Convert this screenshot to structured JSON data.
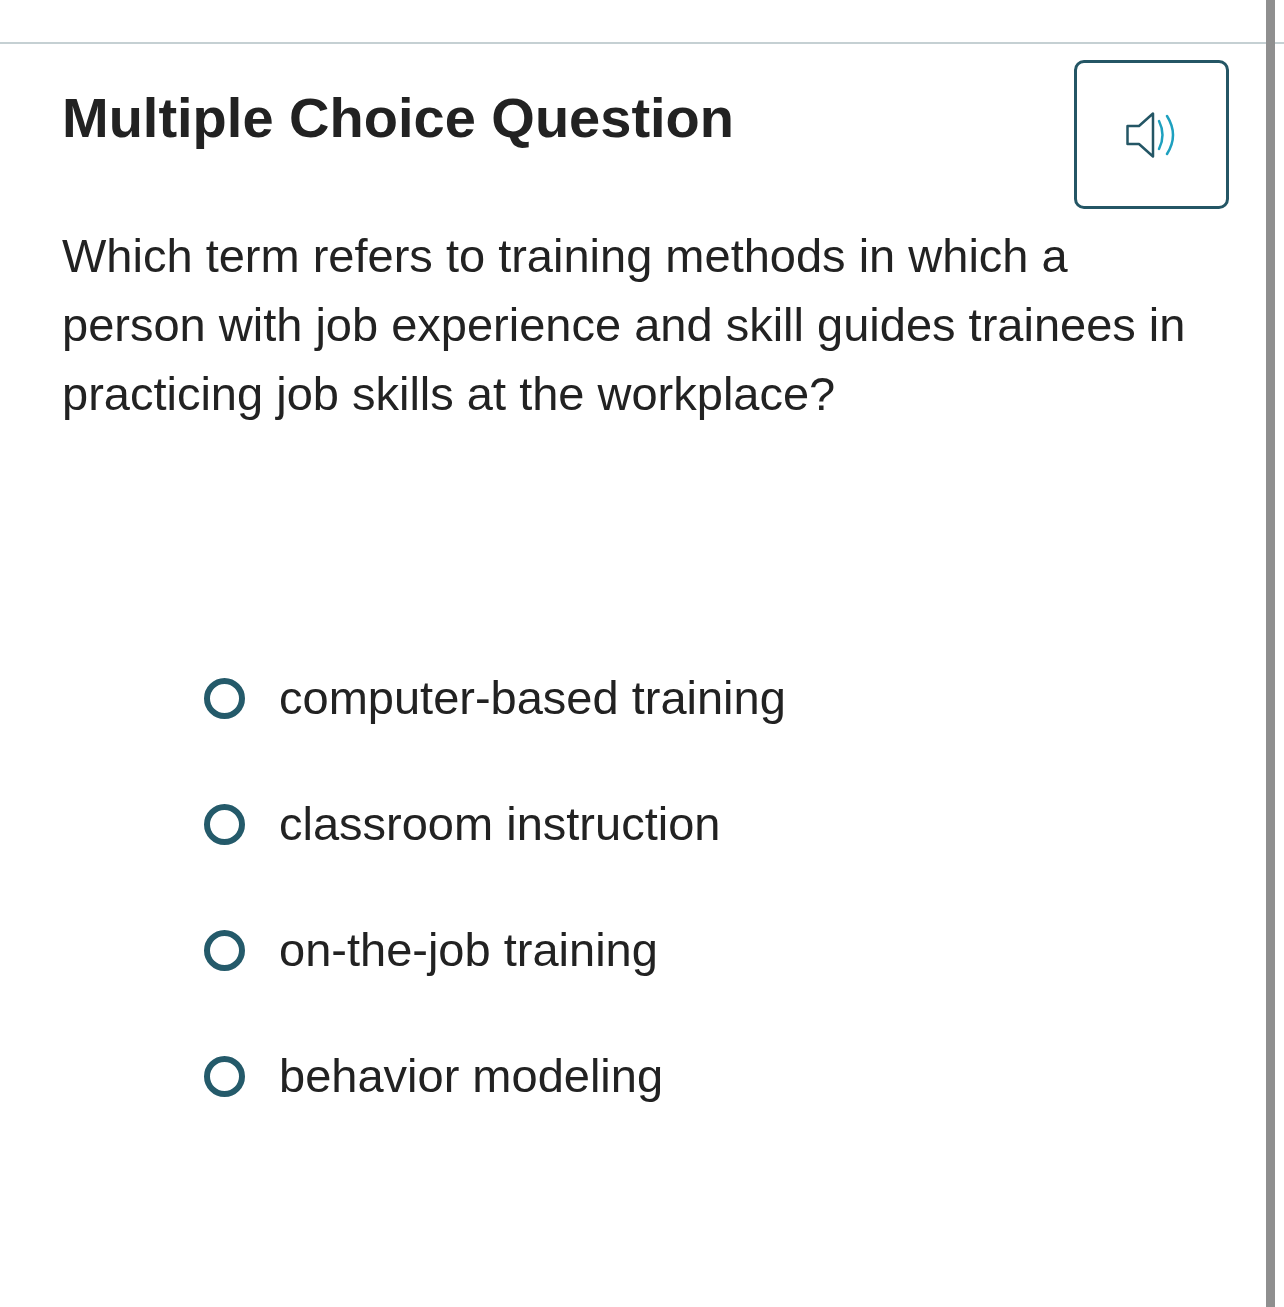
{
  "title": "Multiple Choice Question",
  "question": "Which term refers to training methods in which a person with job experience and skill guides trainees in practicing job skills at the workplace?",
  "options": [
    {
      "label": "computer-based training",
      "selected": false
    },
    {
      "label": "classroom instruction",
      "selected": false
    },
    {
      "label": "on-the-job training",
      "selected": false
    },
    {
      "label": "behavior modeling",
      "selected": false
    }
  ]
}
